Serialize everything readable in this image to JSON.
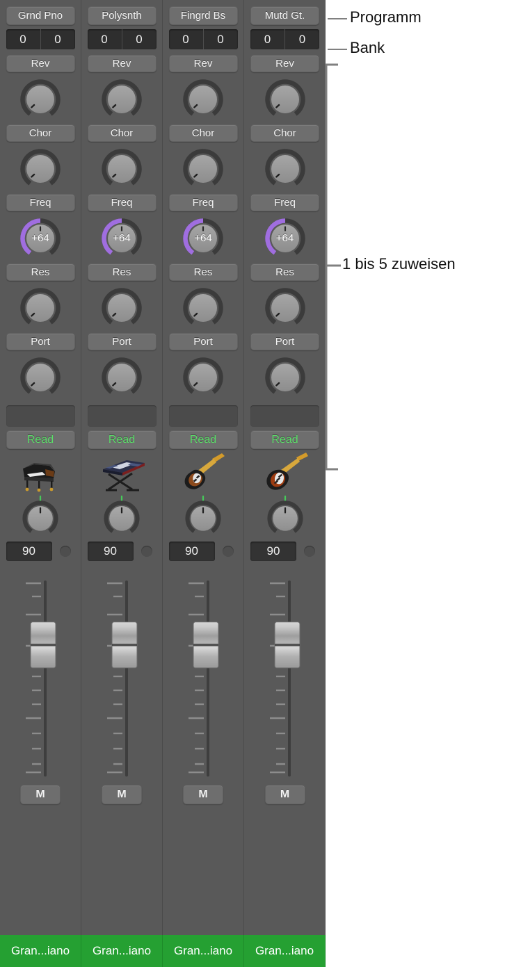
{
  "colors": {
    "panel_background": "#595959",
    "button_face": "#6e6e6e",
    "display_dark": "#2e2e2e",
    "accent_purple": "#a06ee0",
    "accent_green": "#5cdd6a",
    "name_plate_green": "#25a032",
    "knob_cap": "#9a9a9a",
    "annotation_line": "#808080",
    "annotation_text": "#111111"
  },
  "annotations": [
    {
      "id": "programm",
      "label": "Programm"
    },
    {
      "id": "bank",
      "label": "Bank"
    },
    {
      "id": "assign",
      "label": "1 bis 5 zuweisen"
    }
  ],
  "parameter_labels": [
    "Rev",
    "Chor",
    "Freq",
    "Res",
    "Port"
  ],
  "channels": [
    {
      "program_label": "Grnd Pno",
      "bank": "0",
      "program_number": "0",
      "knobs": [
        {
          "name": "Rev",
          "value": "",
          "style": "plain",
          "angle": -132
        },
        {
          "name": "Chor",
          "value": "",
          "style": "plain",
          "angle": -132
        },
        {
          "name": "Freq",
          "value": "+64",
          "style": "purple",
          "angle": 0
        },
        {
          "name": "Res",
          "value": "",
          "style": "plain",
          "angle": -132
        },
        {
          "name": "Port",
          "value": "",
          "style": "plain",
          "angle": -132
        }
      ],
      "automation_mode": "Read",
      "instrument_icon": "grand-piano-icon",
      "pan_value": "",
      "pan_angle": 0,
      "level_value": "90",
      "mute_label": "M",
      "track_name": "Gran...iano",
      "fader_position": 0.3
    },
    {
      "program_label": "Polysnth",
      "bank": "0",
      "program_number": "0",
      "knobs": [
        {
          "name": "Rev",
          "value": "",
          "style": "plain",
          "angle": -132
        },
        {
          "name": "Chor",
          "value": "",
          "style": "plain",
          "angle": -132
        },
        {
          "name": "Freq",
          "value": "+64",
          "style": "purple",
          "angle": 0
        },
        {
          "name": "Res",
          "value": "",
          "style": "plain",
          "angle": -132
        },
        {
          "name": "Port",
          "value": "",
          "style": "plain",
          "angle": -132
        }
      ],
      "automation_mode": "Read",
      "instrument_icon": "keyboard-stand-icon",
      "pan_value": "",
      "pan_angle": 0,
      "level_value": "90",
      "mute_label": "M",
      "track_name": "Gran...iano",
      "fader_position": 0.3
    },
    {
      "program_label": "Fingrd Bs",
      "bank": "0",
      "program_number": "0",
      "knobs": [
        {
          "name": "Rev",
          "value": "",
          "style": "plain",
          "angle": -132
        },
        {
          "name": "Chor",
          "value": "",
          "style": "plain",
          "angle": -132
        },
        {
          "name": "Freq",
          "value": "+64",
          "style": "purple",
          "angle": 0
        },
        {
          "name": "Res",
          "value": "",
          "style": "plain",
          "angle": -132
        },
        {
          "name": "Port",
          "value": "",
          "style": "plain",
          "angle": -132
        }
      ],
      "automation_mode": "Read",
      "instrument_icon": "bass-guitar-icon",
      "pan_value": "",
      "pan_angle": 0,
      "level_value": "90",
      "mute_label": "M",
      "track_name": "Gran...iano",
      "fader_position": 0.3
    },
    {
      "program_label": "Mutd Gt.",
      "bank": "0",
      "program_number": "0",
      "knobs": [
        {
          "name": "Rev",
          "value": "",
          "style": "plain",
          "angle": -132
        },
        {
          "name": "Chor",
          "value": "",
          "style": "plain",
          "angle": -132
        },
        {
          "name": "Freq",
          "value": "+64",
          "style": "purple",
          "angle": 0
        },
        {
          "name": "Res",
          "value": "",
          "style": "plain",
          "angle": -132
        },
        {
          "name": "Port",
          "value": "",
          "style": "plain",
          "angle": -132
        }
      ],
      "automation_mode": "Read",
      "instrument_icon": "electric-guitar-icon",
      "pan_value": "",
      "pan_angle": 0,
      "level_value": "90",
      "mute_label": "M",
      "track_name": "Gran...iano",
      "fader_position": 0.3
    }
  ]
}
